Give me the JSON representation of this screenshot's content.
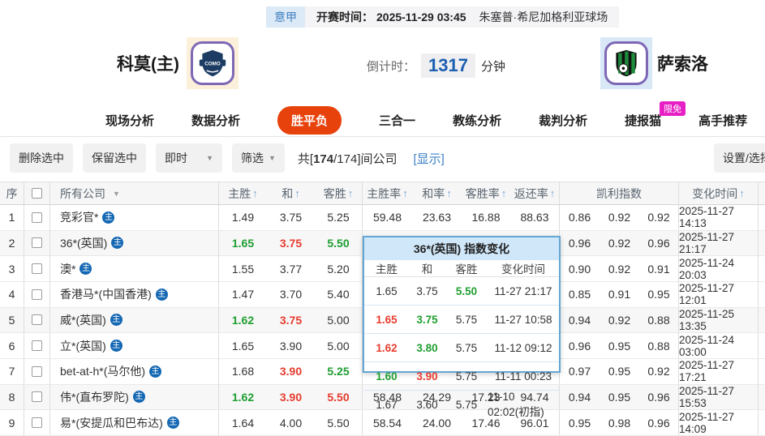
{
  "colors": {
    "accent_orange": "#e8420c",
    "green": "#1f9e30",
    "red": "#e63c2e",
    "link_blue": "#3e82c8",
    "badge_magenta": "#e720c5",
    "popup_border": "#64a6d4",
    "home_icon_blue": "#1467b3"
  },
  "header": {
    "league": "意甲",
    "kickoff_label": "开赛时间：",
    "kickoff_time": "2025-11-29 03:45",
    "venue": "朱塞普·希尼加格利亚球场",
    "home_team": "科莫(主)",
    "away_team": "萨索洛",
    "home_logo_text": "COMO",
    "countdown_label": "倒计时：",
    "countdown_value": "1317",
    "countdown_unit": "分钟"
  },
  "tabs": [
    {
      "label": "现场分析",
      "active": false
    },
    {
      "label": "数据分析",
      "active": false
    },
    {
      "label": "胜平负",
      "active": true
    },
    {
      "label": "三合一",
      "active": false
    },
    {
      "label": "教练分析",
      "active": false
    },
    {
      "label": "裁判分析",
      "active": false
    },
    {
      "label": "捷报猫",
      "active": false,
      "badge": "限免"
    },
    {
      "label": "高手推荐",
      "active": false
    }
  ],
  "toolbar": {
    "delete_selected": "删除选中",
    "keep_selected": "保留选中",
    "live_dropdown": "即时",
    "filter_dropdown": "筛选",
    "count_prefix": "共[",
    "count_bold": "174",
    "count_rest": "/174]间公司",
    "show_link": "[显示]",
    "settings_button": "设置/选择"
  },
  "table": {
    "columns": {
      "index": "序",
      "company": "所有公司",
      "odds": [
        "主胜",
        "和",
        "客胜"
      ],
      "rates": [
        "主胜率",
        "和率",
        "客胜率",
        "返还率"
      ],
      "kelly": "凯利指数",
      "time": "变化时间"
    },
    "rows": [
      {
        "no": "1",
        "company": "竞彩官*",
        "shaded": false,
        "odds": [
          {
            "v": "1.49",
            "c": ""
          },
          {
            "v": "3.75",
            "c": ""
          },
          {
            "v": "5.25",
            "c": ""
          }
        ],
        "rates": [
          "59.48",
          "23.63",
          "16.88",
          "88.63"
        ],
        "kelly": [
          "0.86",
          "0.92",
          "0.92"
        ],
        "time": "2025-11-27 14:13"
      },
      {
        "no": "2",
        "company": "36*(英国)",
        "shaded": true,
        "odds": [
          {
            "v": "1.65",
            "c": "g"
          },
          {
            "v": "3.75",
            "c": "r"
          },
          {
            "v": "5.50",
            "c": "g"
          }
        ],
        "rates": [
          "",
          "",
          "",
          ""
        ],
        "kelly": [
          "0.96",
          "0.92",
          "0.96"
        ],
        "time": "2025-11-27 21:17"
      },
      {
        "no": "3",
        "company": "澳*",
        "shaded": false,
        "odds": [
          {
            "v": "1.55",
            "c": ""
          },
          {
            "v": "3.77",
            "c": ""
          },
          {
            "v": "5.20",
            "c": ""
          }
        ],
        "rates": [
          "",
          "",
          "",
          ""
        ],
        "kelly": [
          "0.90",
          "0.92",
          "0.91"
        ],
        "time": "2025-11-24 20:03"
      },
      {
        "no": "4",
        "company": "香港马*(中国香港)",
        "shaded": false,
        "odds": [
          {
            "v": "1.47",
            "c": ""
          },
          {
            "v": "3.70",
            "c": ""
          },
          {
            "v": "5.40",
            "c": ""
          }
        ],
        "rates": [
          "",
          "",
          "",
          ""
        ],
        "kelly": [
          "0.85",
          "0.91",
          "0.95"
        ],
        "time": "2025-11-27 12:01"
      },
      {
        "no": "5",
        "company": "威*(英国)",
        "shaded": true,
        "odds": [
          {
            "v": "1.62",
            "c": "g"
          },
          {
            "v": "3.75",
            "c": "r"
          },
          {
            "v": "5.00",
            "c": ""
          }
        ],
        "rates": [
          "",
          "",
          "",
          ""
        ],
        "kelly": [
          "0.94",
          "0.92",
          "0.88"
        ],
        "time": "2025-11-25 13:35"
      },
      {
        "no": "6",
        "company": "立*(英国)",
        "shaded": false,
        "odds": [
          {
            "v": "1.65",
            "c": ""
          },
          {
            "v": "3.90",
            "c": ""
          },
          {
            "v": "5.00",
            "c": ""
          }
        ],
        "rates": [
          "",
          "",
          "",
          ""
        ],
        "kelly": [
          "0.96",
          "0.95",
          "0.88"
        ],
        "time": "2025-11-24 03:00"
      },
      {
        "no": "7",
        "company": "bet-at-h*(马尔他)",
        "shaded": false,
        "odds": [
          {
            "v": "1.68",
            "c": ""
          },
          {
            "v": "3.90",
            "c": "r"
          },
          {
            "v": "5.25",
            "c": "g"
          }
        ],
        "rates": [
          "",
          "",
          "",
          ""
        ],
        "kelly": [
          "0.97",
          "0.95",
          "0.92"
        ],
        "time": "2025-11-27 17:21"
      },
      {
        "no": "8",
        "company": "伟*(直布罗陀)",
        "shaded": true,
        "odds": [
          {
            "v": "1.62",
            "c": "g"
          },
          {
            "v": "3.90",
            "c": "r"
          },
          {
            "v": "5.50",
            "c": "r"
          }
        ],
        "rates": [
          "58.48",
          "24.29",
          "17.23",
          "94.74"
        ],
        "kelly": [
          "0.94",
          "0.95",
          "0.96"
        ],
        "time": "2025-11-27 15:53"
      },
      {
        "no": "9",
        "company": "易*(安提瓜和巴布达)",
        "shaded": false,
        "odds": [
          {
            "v": "1.64",
            "c": ""
          },
          {
            "v": "4.00",
            "c": ""
          },
          {
            "v": "5.50",
            "c": ""
          }
        ],
        "rates": [
          "58.54",
          "24.00",
          "17.46",
          "96.01"
        ],
        "kelly": [
          "0.95",
          "0.98",
          "0.96"
        ],
        "time": "2025-11-27 14:09"
      }
    ]
  },
  "popup": {
    "title": "36*(英国) 指数变化",
    "columns": [
      "主胜",
      "和",
      "客胜",
      "变化时间"
    ],
    "rows": [
      {
        "vals": [
          {
            "v": "1.65",
            "c": ""
          },
          {
            "v": "3.75",
            "c": ""
          },
          {
            "v": "5.50",
            "c": "g"
          }
        ],
        "time": "11-27 21:17"
      },
      {
        "vals": [
          {
            "v": "1.65",
            "c": "r"
          },
          {
            "v": "3.75",
            "c": "g"
          },
          {
            "v": "5.75",
            "c": ""
          }
        ],
        "time": "11-27 10:58"
      },
      {
        "vals": [
          {
            "v": "1.62",
            "c": "r"
          },
          {
            "v": "3.80",
            "c": "g"
          },
          {
            "v": "5.75",
            "c": ""
          }
        ],
        "time": "11-12 09:12"
      },
      {
        "vals": [
          {
            "v": "1.60",
            "c": "g"
          },
          {
            "v": "3.90",
            "c": "r"
          },
          {
            "v": "5.75",
            "c": ""
          }
        ],
        "time": "11-11 00:23"
      },
      {
        "vals": [
          {
            "v": "1.67",
            "c": ""
          },
          {
            "v": "3.60",
            "c": ""
          },
          {
            "v": "5.75",
            "c": ""
          }
        ],
        "time": "11-10 02:02(初指)"
      }
    ]
  }
}
